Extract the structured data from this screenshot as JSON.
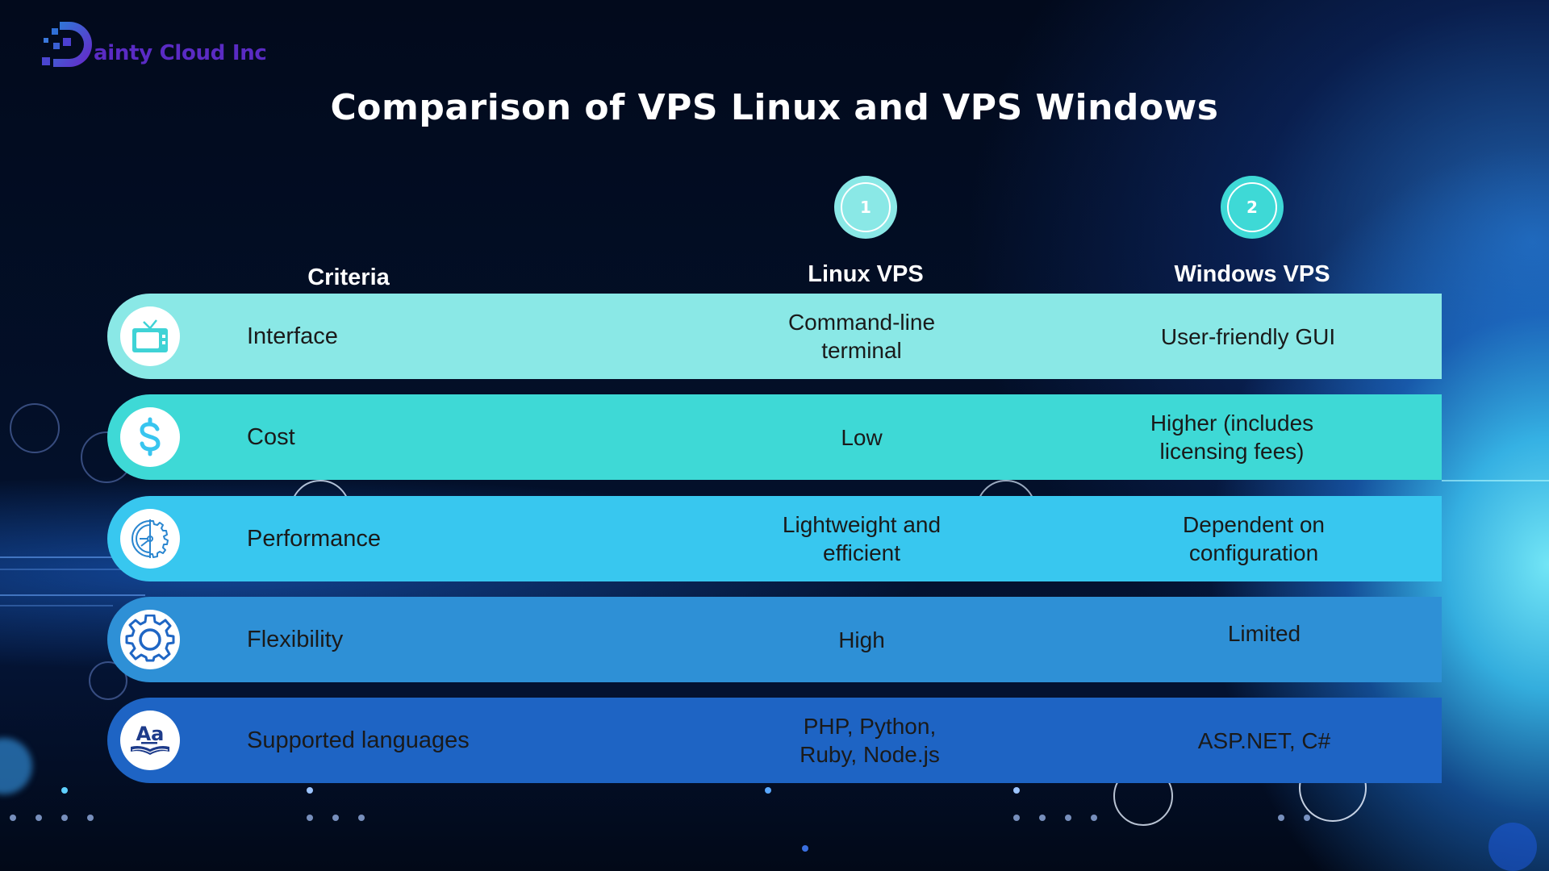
{
  "brand": {
    "name": "ainty Cloud Inc",
    "logo_letter": "D",
    "color": "#5a2bc4"
  },
  "title": "Comparison of VPS Linux and VPS Windows",
  "columns": {
    "criteria": "Criteria",
    "linux": {
      "number": "1",
      "label": "Linux VPS",
      "color": "#8ae8e6"
    },
    "windows": {
      "number": "2",
      "label": "Windows VPS",
      "color": "#3ed9d6"
    }
  },
  "rows": [
    {
      "icon": "tv-icon",
      "criteria": "Interface",
      "linux": "Command-line\nterminal",
      "windows": "User-friendly GUI",
      "color": "#8ae8e6",
      "icon_color": "#3fd3d6"
    },
    {
      "icon": "dollar-icon",
      "criteria": "Cost",
      "linux": "Low",
      "windows": "Higher (includes\nlicensing fees)",
      "color": "#3ed9d6",
      "icon_color": "#38c5ef"
    },
    {
      "icon": "performance-gauge-icon",
      "criteria": "Performance",
      "linux": "Lightweight and\nefficient",
      "windows": "Dependent on\nconfiguration",
      "color": "#38c7ef",
      "icon_color": "#2a86d0"
    },
    {
      "icon": "gear-icon",
      "criteria": "Flexibility",
      "linux": "High",
      "windows": "Limited",
      "color": "#2e90d6",
      "icon_color": "#1f66c4"
    },
    {
      "icon": "language-book-icon",
      "criteria": "Supported languages",
      "linux": "PHP, Python,\nRuby, Node.js",
      "windows": "ASP.NET, C#",
      "color": "#1e64c4",
      "icon_color": "#1d3b8a"
    }
  ]
}
